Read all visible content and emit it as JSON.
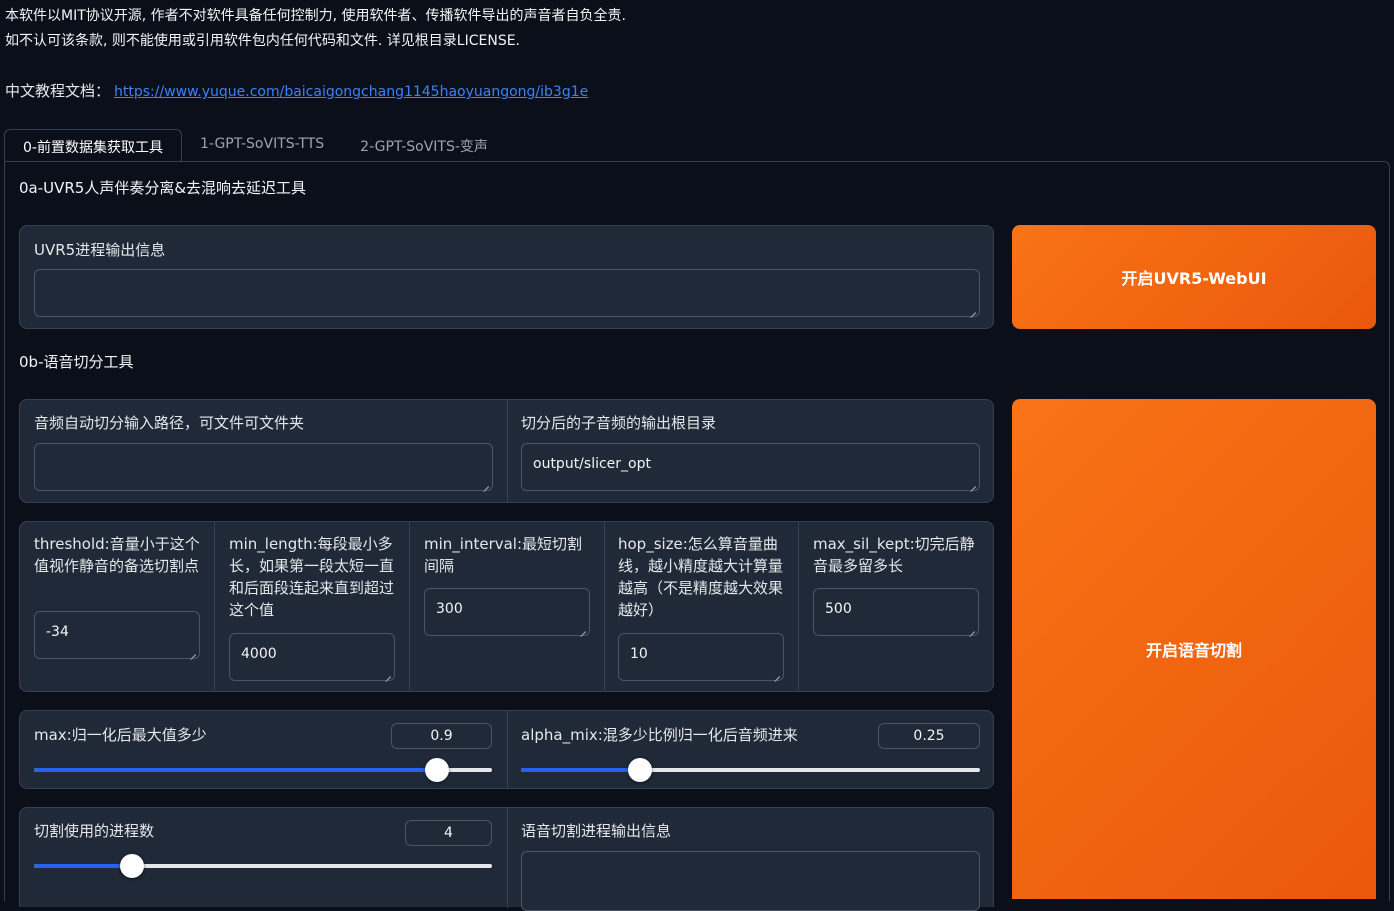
{
  "intro": {
    "line1": "本软件以MIT协议开源, 作者不对软件具备任何控制力, 使用软件者、传播软件导出的声音者自负全责.",
    "line2": "如不认可该条款, 则不能使用或引用软件包内任何代码和文件. 详见根目录LICENSE."
  },
  "doc": {
    "label": "中文教程文档：",
    "link": "https://www.yuque.com/baicaigongchang1145haoyuangong/ib3g1e"
  },
  "tabs": [
    "0-前置数据集获取工具",
    "1-GPT-SoVITS-TTS",
    "2-GPT-SoVITS-变声"
  ],
  "uvr": {
    "section_title": "0a-UVR5人声伴奏分离&去混响去延迟工具",
    "output_label": "UVR5进程输出信息",
    "output_value": "",
    "button": "开启UVR5-WebUI"
  },
  "slicer": {
    "section_title": "0b-语音切分工具",
    "input_path_label": "音频自动切分输入路径，可文件可文件夹",
    "input_path_value": "",
    "output_dir_label": "切分后的子音频的输出根目录",
    "output_dir_value": "output/slicer_opt",
    "params": [
      {
        "label": "threshold:音量小于这个值视作静音的备选切割点",
        "value": "-34"
      },
      {
        "label": "min_length:每段最小多长，如果第一段太短一直和后面段连起来直到超过这个值",
        "value": "4000"
      },
      {
        "label": "min_interval:最短切割间隔",
        "value": "300"
      },
      {
        "label": "hop_size:怎么算音量曲线，越小精度越大计算量越高（不是精度越大效果越好）",
        "value": "10"
      },
      {
        "label": "max_sil_kept:切完后静音最多留多长",
        "value": "500"
      }
    ],
    "max": {
      "label": "max:归一化后最大值多少",
      "value": "0.9",
      "fraction": 0.88
    },
    "alpha": {
      "label": "alpha_mix:混多少比例归一化后音频进来",
      "value": "0.25",
      "fraction": 0.26
    },
    "procs": {
      "label": "切割使用的进程数",
      "value": "4",
      "fraction": 0.215
    },
    "output_label": "语音切割进程输出信息",
    "button": "开启语音切割"
  },
  "colors": {
    "accent": "#f97316",
    "slider": "#2563eb",
    "link": "#3b82f6"
  }
}
